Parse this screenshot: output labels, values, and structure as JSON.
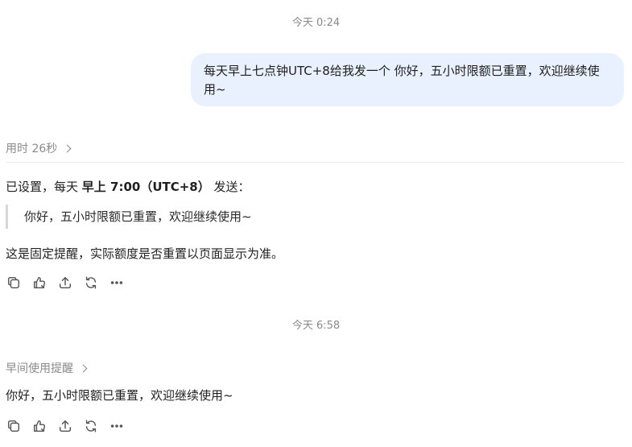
{
  "conversation": {
    "timestamp_1": "今天 0:24",
    "user_message": "每天早上七点钟UTC+8给我发一个 你好，五小时限额已重置，欢迎继续使用~",
    "thinking_label": "用时 26秒",
    "reply_prefix": "已设置，每天 ",
    "reply_bold": "早上 7:00（UTC+8）",
    "reply_suffix": " 发送：",
    "reply_quote": "你好，五小时限额已重置，欢迎继续使用~",
    "reply_note": "这是固定提醒，实际额度是否重置以页面显示为准。",
    "timestamp_2": "今天 6:58",
    "task_label": "早间使用提醒",
    "task_message": "你好，五小时限额已重置，欢迎继续使用~"
  },
  "icons": {
    "copy": "copy-icon",
    "feedback": "thumbs-icon",
    "share": "share-icon",
    "regenerate": "refresh-icon",
    "more": "more-icon"
  }
}
